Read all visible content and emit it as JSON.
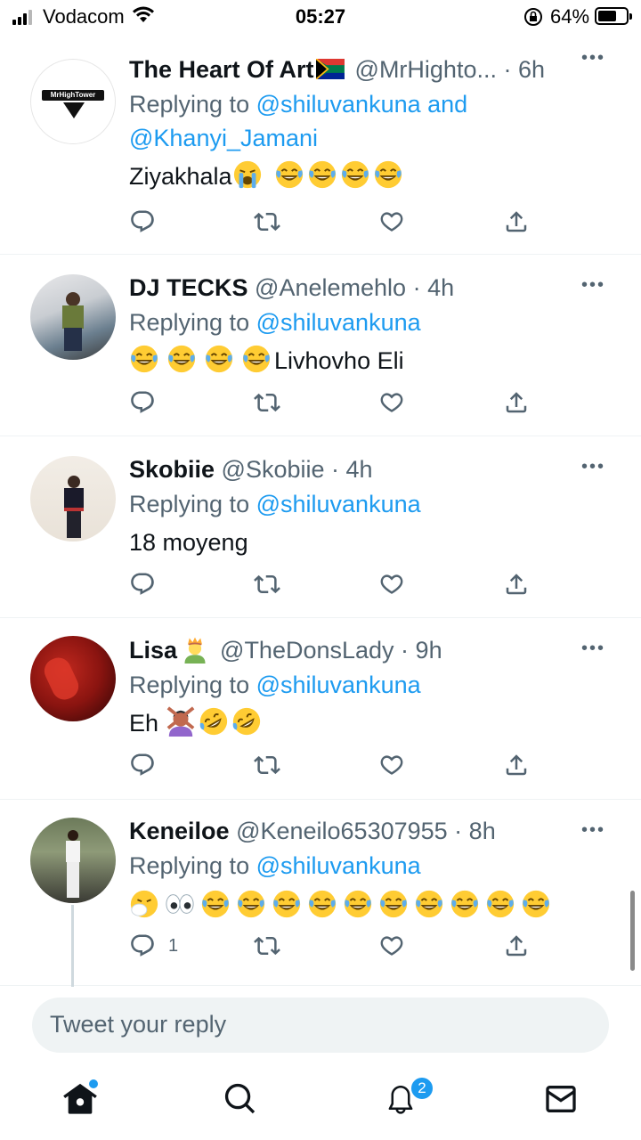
{
  "status_bar": {
    "carrier": "Vodacom",
    "time": "05:27",
    "battery": "64%",
    "battery_level": 0.64
  },
  "tweets": [
    {
      "name": "The Heart Of Art",
      "name_emoji": "south-africa-flag",
      "handle": "@MrHighto...",
      "time": "6h",
      "replying_prefix": "Replying to ",
      "replying_to": "@shiluvankuna",
      "replying_and": " and",
      "replying_to_2": "@Khanyi_Jamani",
      "text": "Ziyakhala",
      "emojis": [
        "loudly-crying-face",
        "joy-face",
        "joy-face",
        "joy-face",
        "joy-face"
      ],
      "avatar_logo_text": "MrHighTower"
    },
    {
      "name": "DJ TECKS",
      "handle": "@Anelemehlo",
      "time": "4h",
      "replying_prefix": "Replying to ",
      "replying_to": "@shiluvankuna",
      "emojis_before": [
        "joy-face",
        "joy-face",
        "joy-face",
        "joy-face"
      ],
      "text": "Livhovho Eli"
    },
    {
      "name": "Skobiie",
      "handle": "@Skobiie",
      "time": "4h",
      "replying_prefix": "Replying to ",
      "replying_to": "@shiluvankuna",
      "text": "18 moyeng"
    },
    {
      "name": "Lisa",
      "name_emoji": "person-with-crown",
      "handle": "@TheDonsLady",
      "time": "9h",
      "replying_prefix": "Replying to ",
      "replying_to": "@shiluvankuna",
      "text": "Eh",
      "emojis": [
        "person-gesturing-no",
        "rofl-face",
        "rofl-face"
      ]
    },
    {
      "name": "Keneiloe",
      "handle": "@Keneilo65307955",
      "time": "8h",
      "replying_prefix": "Replying to ",
      "replying_to": "@shiluvankuna",
      "emojis": [
        "sneezing-face",
        "eyes",
        "joy-face",
        "joy-face",
        "joy-face",
        "joy-face",
        "joy-face",
        "joy-face",
        "joy-face",
        "joy-face",
        "joy-face",
        "joy-face"
      ],
      "reply_count": "1"
    }
  ],
  "separator": " · ",
  "reply_box": {
    "placeholder": "Tweet your reply"
  },
  "bottom_nav": {
    "items": [
      "home-icon",
      "search-icon",
      "notifications-icon",
      "messages-icon"
    ],
    "notification_badge": "2"
  },
  "colors": {
    "accent": "#1d9bf0",
    "secondary_text": "#536471",
    "primary_text": "#0f1419"
  }
}
